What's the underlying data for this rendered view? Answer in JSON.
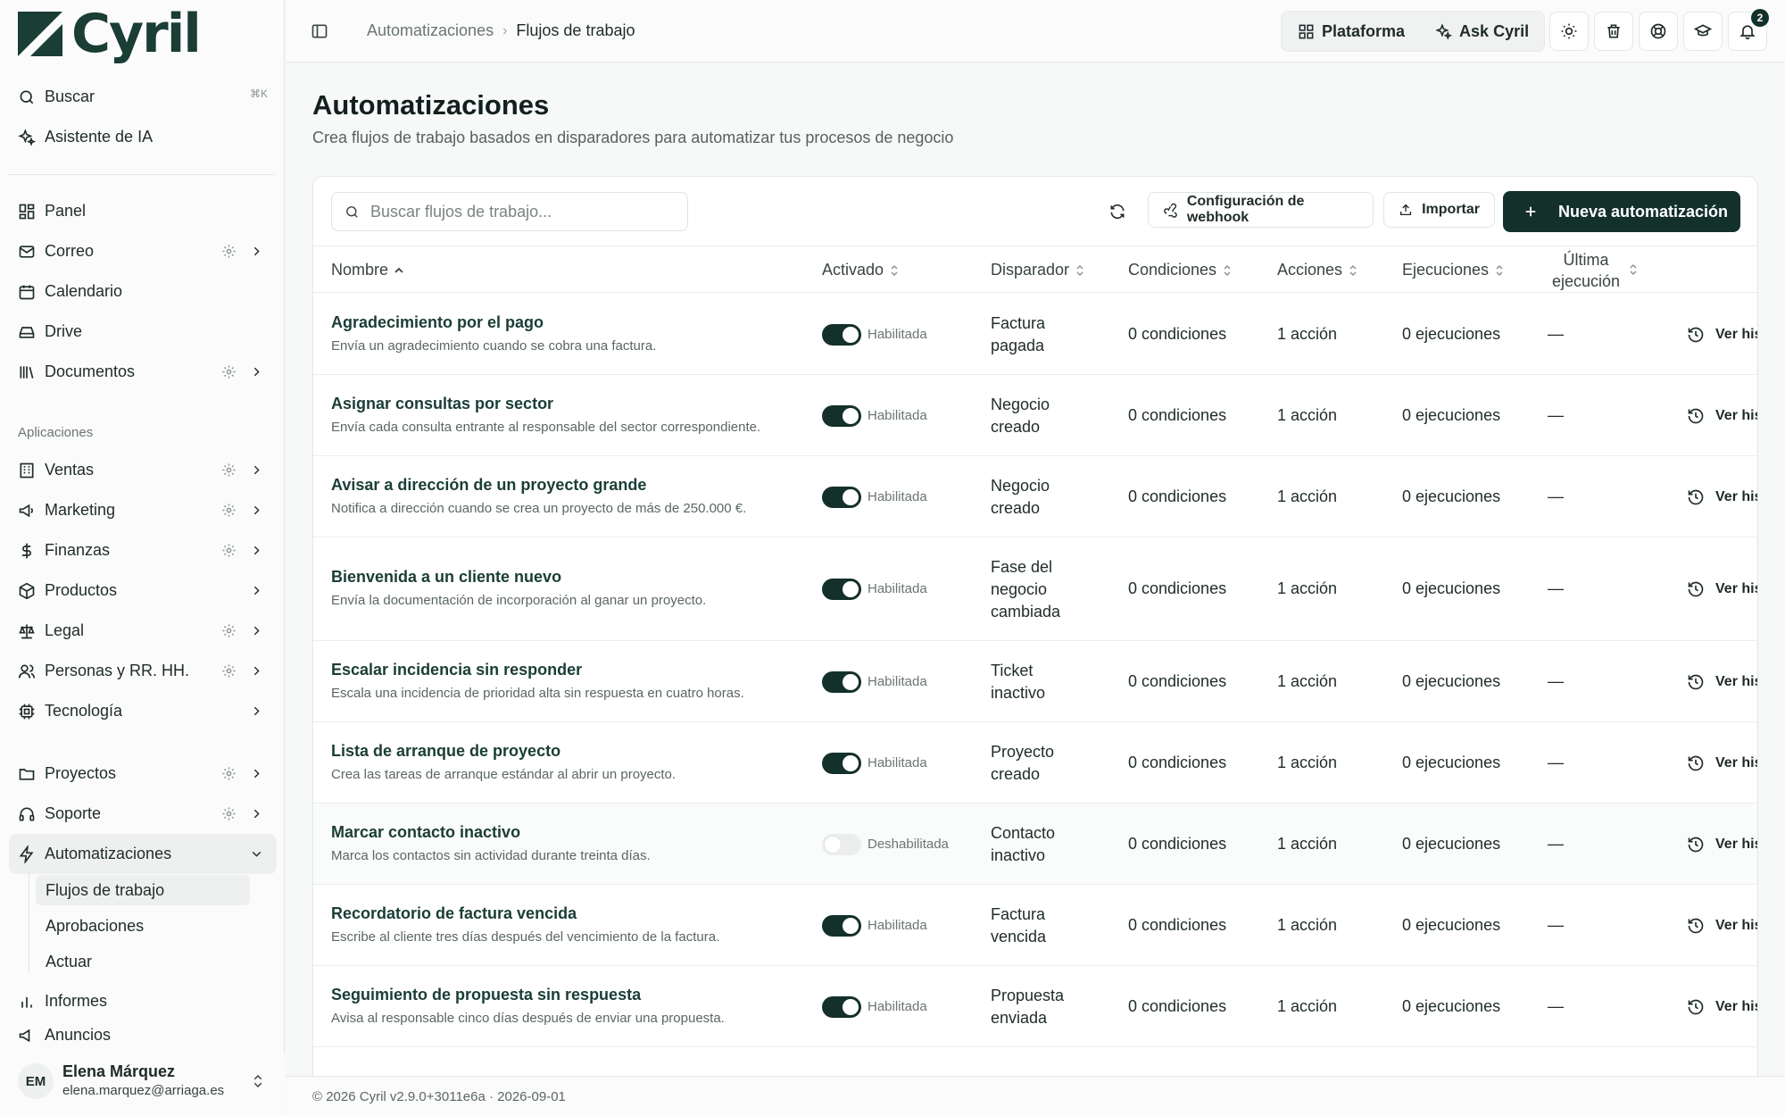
{
  "app": {
    "name": "Cyril"
  },
  "sidebar": {
    "search_label": "Buscar",
    "search_shortcut": "⌘K",
    "ai_label": "Asistente de IA",
    "items_top": [
      {
        "label": "Panel",
        "icon": "dashboard-icon"
      },
      {
        "label": "Correo",
        "icon": "mail-icon"
      },
      {
        "label": "Calendario",
        "icon": "calendar-icon"
      },
      {
        "label": "Drive",
        "icon": "drive-icon"
      },
      {
        "label": "Documentos",
        "icon": "library-icon"
      }
    ],
    "apps_heading": "Aplicaciones",
    "apps": [
      {
        "label": "Ventas",
        "icon": "building-icon"
      },
      {
        "label": "Marketing",
        "icon": "megaphone-icon"
      },
      {
        "label": "Finanzas",
        "icon": "dollar-icon"
      },
      {
        "label": "Productos",
        "icon": "package-icon"
      },
      {
        "label": "Legal",
        "icon": "scale-icon"
      },
      {
        "label": "Personas y RR. HH.",
        "icon": "users-icon"
      },
      {
        "label": "Tecnología",
        "icon": "cpu-icon"
      }
    ],
    "projects_label": "Proyectos",
    "support_label": "Soporte",
    "automations_label": "Automatizaciones",
    "automations_sub": [
      "Flujos de trabajo",
      "Aprobaciones",
      "Actuar"
    ],
    "reports_label": "Informes",
    "ads_label": "Anuncios",
    "user": {
      "initials": "EM",
      "name": "Elena Márquez",
      "email": "elena.marquez@arriaga.es"
    }
  },
  "header": {
    "breadcrumb": [
      "Automatizaciones",
      "Flujos de trabajo"
    ],
    "platform_label": "Plataforma",
    "ask_label": "Ask Cyril",
    "notifications_count": "2"
  },
  "main": {
    "title": "Automatizaciones",
    "subtitle": "Crea flujos de trabajo basados en disparadores para automatizar tus procesos de negocio",
    "search_placeholder": "Buscar flujos de trabajo...",
    "webhook_label": "Configuración de webhook",
    "import_label": "Importar",
    "new_label": "Nueva automatización",
    "columns": {
      "name": "Nombre",
      "enabled": "Activado",
      "trigger": "Disparador",
      "conditions": "Condiciones",
      "actions": "Acciones",
      "executions": "Ejecuciones",
      "last_1": "Última",
      "last_2": "ejecución"
    },
    "rows": [
      {
        "name": "Agradecimiento por el pago",
        "desc": "Envía un agradecimiento cuando se cobra una factura.",
        "enabled": true,
        "status": "Habilitada",
        "trigger": [
          "Factura",
          "pagada"
        ],
        "conditions": "0 condiciones",
        "actions": "1 acción",
        "executions": "0 ejecuciones",
        "last": "—",
        "history": "Ver historial"
      },
      {
        "name": "Asignar consultas por sector",
        "desc": "Envía cada consulta entrante al responsable del sector correspondiente.",
        "enabled": true,
        "status": "Habilitada",
        "trigger": [
          "Negocio",
          "creado"
        ],
        "conditions": "0 condiciones",
        "actions": "1 acción",
        "executions": "0 ejecuciones",
        "last": "—",
        "history": "Ver historial"
      },
      {
        "name": "Avisar a dirección de un proyecto grande",
        "desc": "Notifica a dirección cuando se crea un proyecto de más de 250.000 €.",
        "enabled": true,
        "status": "Habilitada",
        "trigger": [
          "Negocio",
          "creado"
        ],
        "conditions": "0 condiciones",
        "actions": "1 acción",
        "executions": "0 ejecuciones",
        "last": "—",
        "history": "Ver historial"
      },
      {
        "name": "Bienvenida a un cliente nuevo",
        "desc": "Envía la documentación de incorporación al ganar un proyecto.",
        "enabled": true,
        "status": "Habilitada",
        "trigger": [
          "Fase del",
          "negocio",
          "cambiada"
        ],
        "conditions": "0 condiciones",
        "actions": "1 acción",
        "executions": "0 ejecuciones",
        "last": "—",
        "history": "Ver historial"
      },
      {
        "name": "Escalar incidencia sin responder",
        "desc": "Escala una incidencia de prioridad alta sin respuesta en cuatro horas.",
        "enabled": true,
        "status": "Habilitada",
        "trigger": [
          "Ticket",
          "inactivo"
        ],
        "conditions": "0 condiciones",
        "actions": "1 acción",
        "executions": "0 ejecuciones",
        "last": "—",
        "history": "Ver historial"
      },
      {
        "name": "Lista de arranque de proyecto",
        "desc": "Crea las tareas de arranque estándar al abrir un proyecto.",
        "enabled": true,
        "status": "Habilitada",
        "trigger": [
          "Proyecto",
          "creado"
        ],
        "conditions": "0 condiciones",
        "actions": "1 acción",
        "executions": "0 ejecuciones",
        "last": "—",
        "history": "Ver historial"
      },
      {
        "name": "Marcar contacto inactivo",
        "desc": "Marca los contactos sin actividad durante treinta días.",
        "enabled": false,
        "status": "Deshabilitada",
        "trigger": [
          "Contacto",
          "inactivo"
        ],
        "conditions": "0 condiciones",
        "actions": "1 acción",
        "executions": "0 ejecuciones",
        "last": "—",
        "history": "Ver historial"
      },
      {
        "name": "Recordatorio de factura vencida",
        "desc": "Escribe al cliente tres días después del vencimiento de la factura.",
        "enabled": true,
        "status": "Habilitada",
        "trigger": [
          "Factura",
          "vencida"
        ],
        "conditions": "0 condiciones",
        "actions": "1 acción",
        "executions": "0 ejecuciones",
        "last": "—",
        "history": "Ver historial"
      },
      {
        "name": "Seguimiento de propuesta sin respuesta",
        "desc": "Avisa al responsable cinco días después de enviar una propuesta.",
        "enabled": true,
        "status": "Habilitada",
        "trigger": [
          "Propuesta",
          "enviada"
        ],
        "conditions": "0 condiciones",
        "actions": "1 acción",
        "executions": "0 ejecuciones",
        "last": "—",
        "history": "Ver historial"
      }
    ]
  },
  "footer": {
    "text": "© 2026 Cyril v2.9.0+3011e6a · 2026-09-01"
  }
}
